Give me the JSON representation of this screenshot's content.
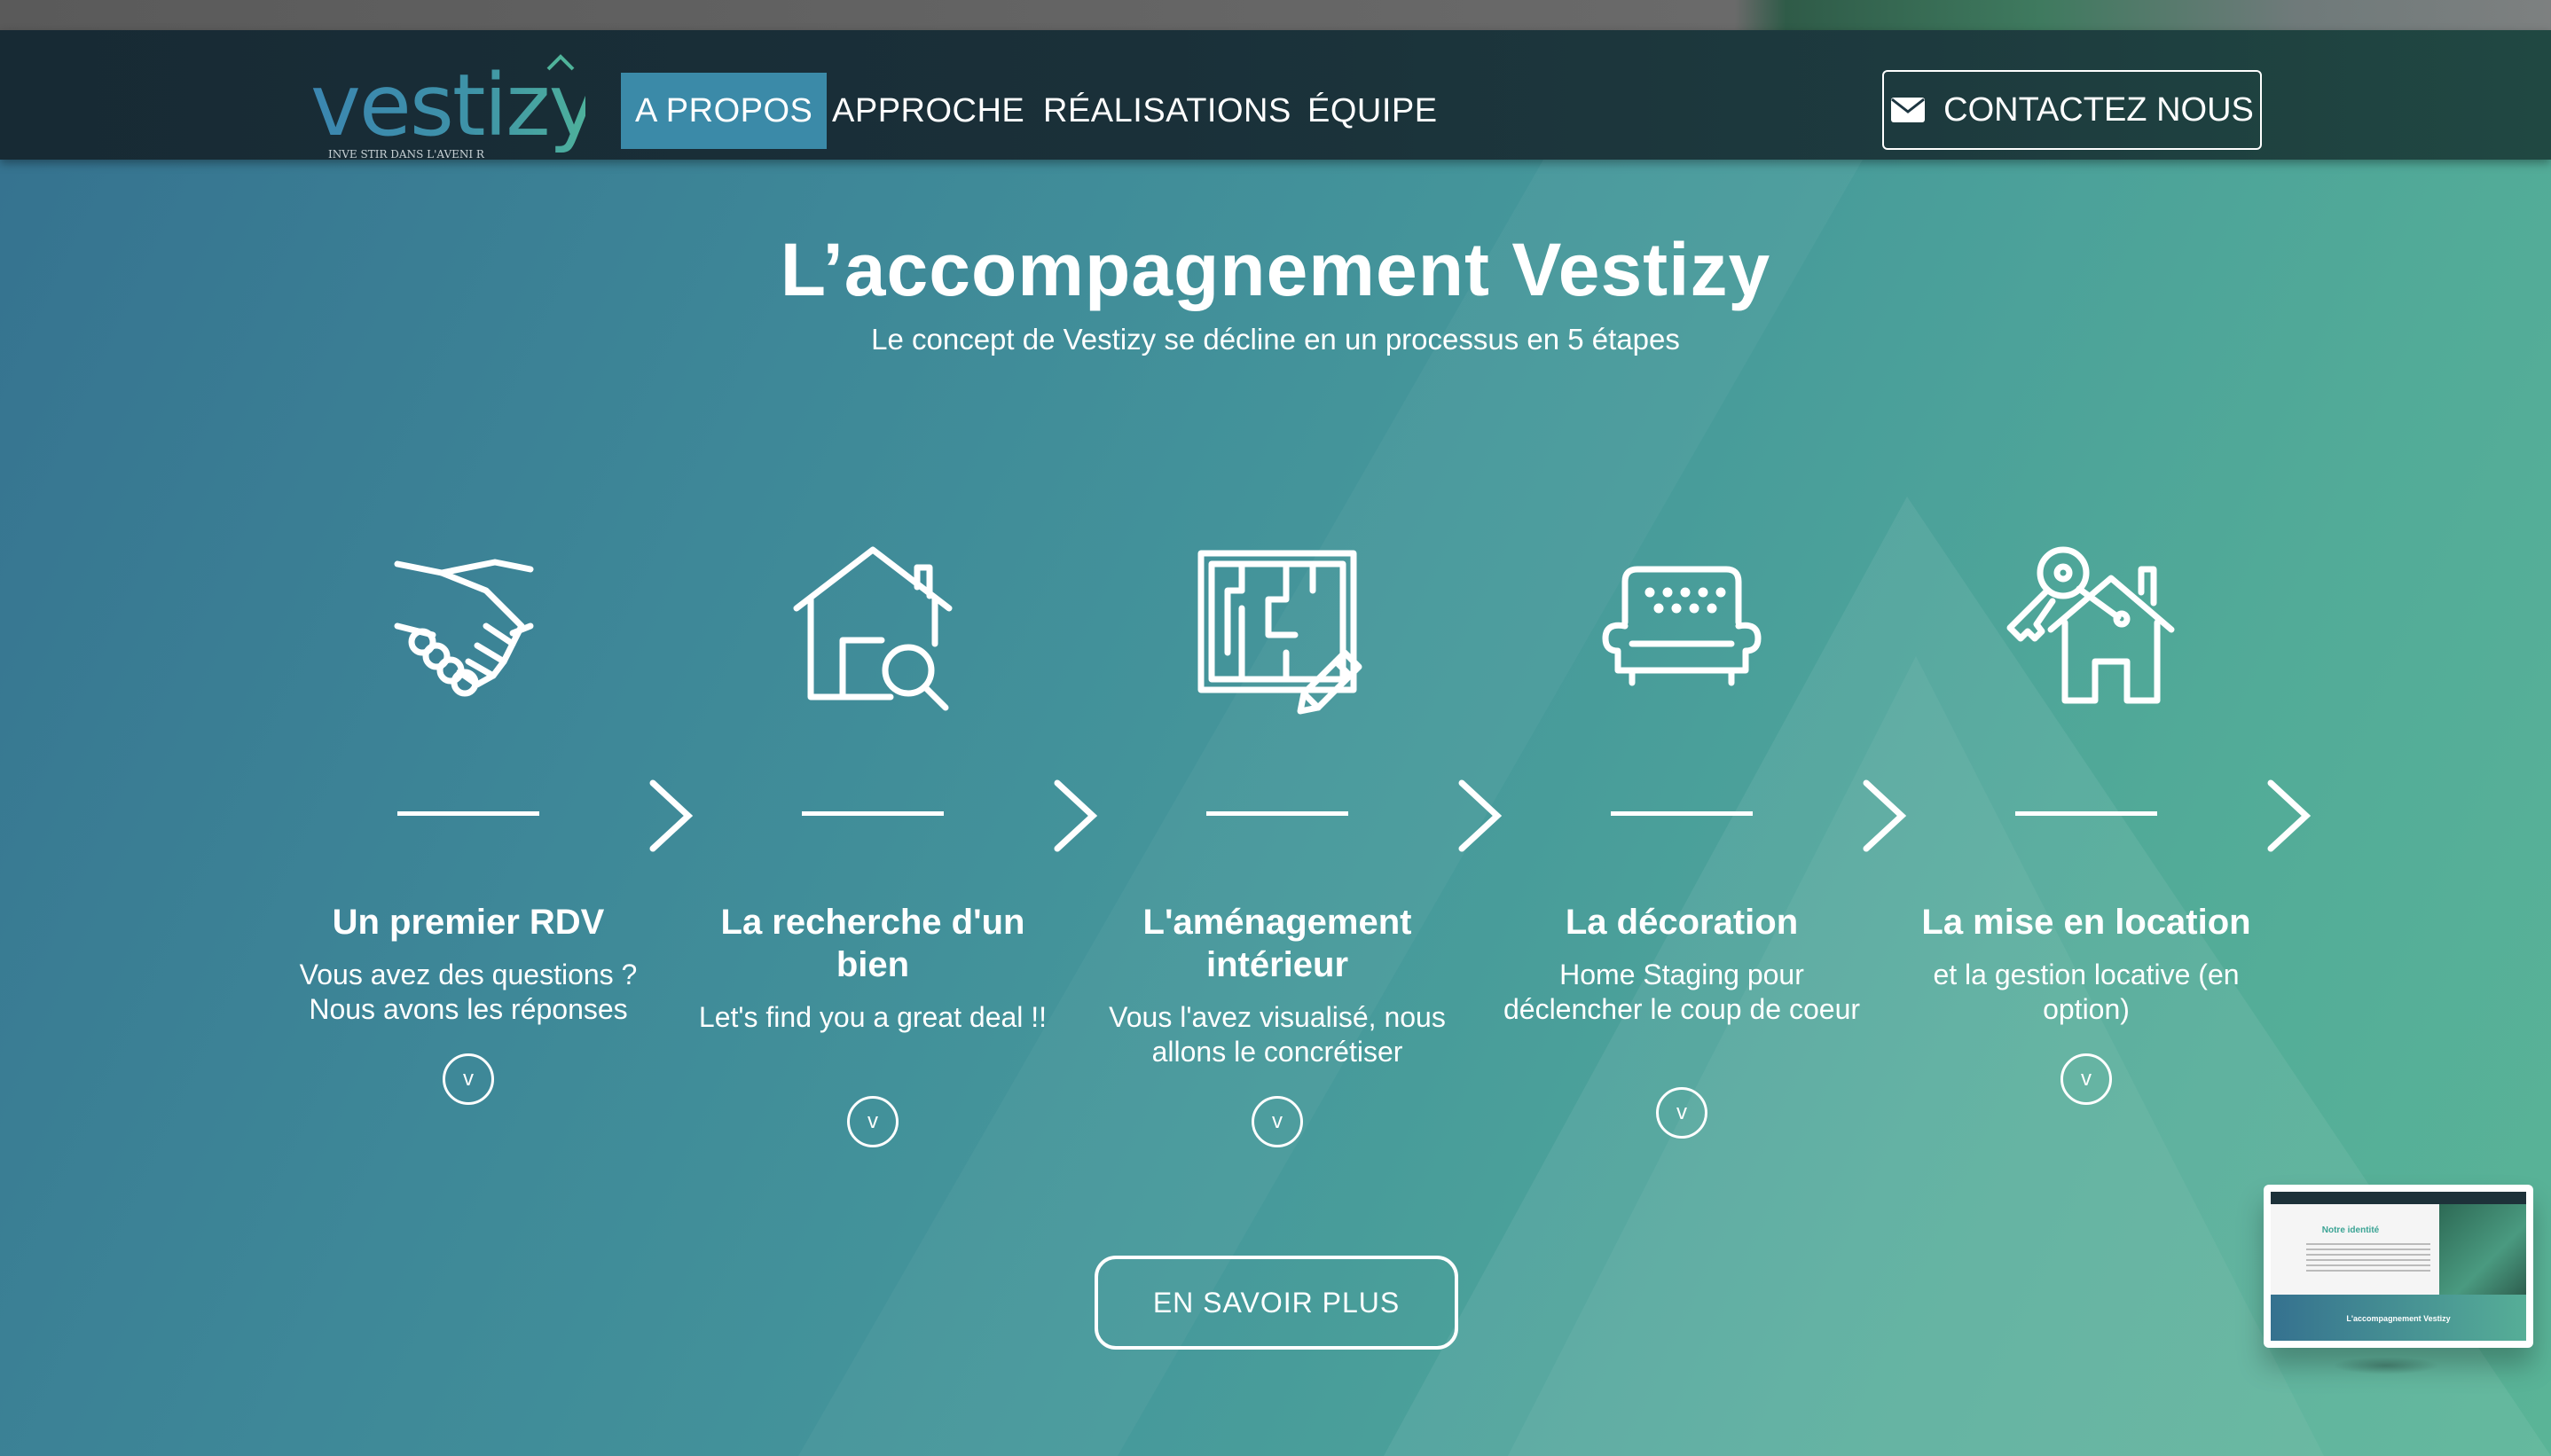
{
  "logo": {
    "text": "vestizy",
    "tagline": "INVE STIR  DANS  L'AVENI R"
  },
  "nav": {
    "items": [
      {
        "label": "A PROPOS",
        "active": true
      },
      {
        "label": "APPROCHE",
        "active": false
      },
      {
        "label": "RÉALISATIONS",
        "active": false
      },
      {
        "label": "ÉQUIPE",
        "active": false
      }
    ],
    "contact_label": "CONTACTEZ NOUS",
    "contact_icon": "envelope-icon"
  },
  "hero": {
    "title": "L’accompagnement Vestizy",
    "subtitle": "Le concept de Vestizy se décline en un processus en 5 étapes"
  },
  "steps": [
    {
      "icon": "handshake-icon",
      "title": "Un premier RDV",
      "desc": "Vous avez des questions ? Nous avons les réponses",
      "toggle": "v"
    },
    {
      "icon": "house-search-icon",
      "title": "La recherche d'un bien",
      "desc": "Let's find you a great deal !!",
      "toggle": "v"
    },
    {
      "icon": "floorplan-pencil-icon",
      "title": "L'aménagement intérieur",
      "desc": "Vous l'avez visualisé, nous allons le concrétiser",
      "toggle": "v"
    },
    {
      "icon": "sofa-icon",
      "title": "La décoration",
      "desc": "Home Staging pour déclencher le coup de coeur",
      "toggle": "v"
    },
    {
      "icon": "house-keys-icon",
      "title": "La mise en location",
      "desc": "et la gestion locative (en option)",
      "toggle": "v"
    }
  ],
  "cta": {
    "label": "EN SAVOIR PLUS"
  },
  "preview": {
    "title": "Notre identité",
    "hero_title": "L'accompagnement Vestizy"
  },
  "colors": {
    "nav_bg": "#1a3039",
    "active_nav": "#3b8aa8",
    "gradient_start": "#35718f",
    "gradient_end": "#5ab497",
    "logo_blue": "#3b86b0",
    "logo_teal": "#4fb39a"
  }
}
